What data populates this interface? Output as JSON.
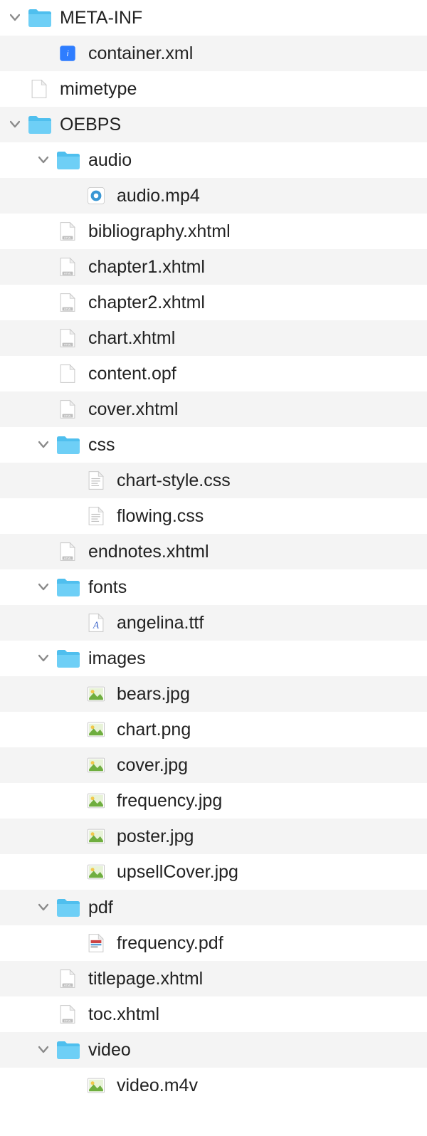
{
  "rows": [
    {
      "depth": 0,
      "expand": "open",
      "icon": "folder",
      "label": "META-INF"
    },
    {
      "depth": 1,
      "expand": "none",
      "icon": "xml",
      "label": "container.xml"
    },
    {
      "depth": 0,
      "expand": "none",
      "icon": "blank",
      "label": "mimetype"
    },
    {
      "depth": 0,
      "expand": "open",
      "icon": "folder",
      "label": "OEBPS"
    },
    {
      "depth": 1,
      "expand": "open",
      "icon": "folder",
      "label": "audio"
    },
    {
      "depth": 2,
      "expand": "none",
      "icon": "media",
      "label": "audio.mp4"
    },
    {
      "depth": 1,
      "expand": "none",
      "icon": "html",
      "label": "bibliography.xhtml"
    },
    {
      "depth": 1,
      "expand": "none",
      "icon": "html",
      "label": "chapter1.xhtml"
    },
    {
      "depth": 1,
      "expand": "none",
      "icon": "html",
      "label": "chapter2.xhtml"
    },
    {
      "depth": 1,
      "expand": "none",
      "icon": "html",
      "label": "chart.xhtml"
    },
    {
      "depth": 1,
      "expand": "none",
      "icon": "blank",
      "label": "content.opf"
    },
    {
      "depth": 1,
      "expand": "none",
      "icon": "html",
      "label": "cover.xhtml"
    },
    {
      "depth": 1,
      "expand": "open",
      "icon": "folder",
      "label": "css"
    },
    {
      "depth": 2,
      "expand": "none",
      "icon": "text",
      "label": "chart-style.css"
    },
    {
      "depth": 2,
      "expand": "none",
      "icon": "text",
      "label": "flowing.css"
    },
    {
      "depth": 1,
      "expand": "none",
      "icon": "html",
      "label": "endnotes.xhtml"
    },
    {
      "depth": 1,
      "expand": "open",
      "icon": "folder",
      "label": "fonts"
    },
    {
      "depth": 2,
      "expand": "none",
      "icon": "font",
      "label": "angelina.ttf"
    },
    {
      "depth": 1,
      "expand": "open",
      "icon": "folder",
      "label": "images"
    },
    {
      "depth": 2,
      "expand": "none",
      "icon": "img",
      "label": "bears.jpg"
    },
    {
      "depth": 2,
      "expand": "none",
      "icon": "img",
      "label": "chart.png"
    },
    {
      "depth": 2,
      "expand": "none",
      "icon": "img",
      "label": "cover.jpg"
    },
    {
      "depth": 2,
      "expand": "none",
      "icon": "img",
      "label": "frequency.jpg"
    },
    {
      "depth": 2,
      "expand": "none",
      "icon": "img",
      "label": "poster.jpg"
    },
    {
      "depth": 2,
      "expand": "none",
      "icon": "img",
      "label": "upsellCover.jpg"
    },
    {
      "depth": 1,
      "expand": "open",
      "icon": "folder",
      "label": "pdf"
    },
    {
      "depth": 2,
      "expand": "none",
      "icon": "pdf",
      "label": "frequency.pdf"
    },
    {
      "depth": 1,
      "expand": "none",
      "icon": "html",
      "label": "titlepage.xhtml"
    },
    {
      "depth": 1,
      "expand": "none",
      "icon": "html",
      "label": "toc.xhtml"
    },
    {
      "depth": 1,
      "expand": "open",
      "icon": "folder",
      "label": "video"
    },
    {
      "depth": 2,
      "expand": "none",
      "icon": "img",
      "label": "video.m4v"
    }
  ]
}
